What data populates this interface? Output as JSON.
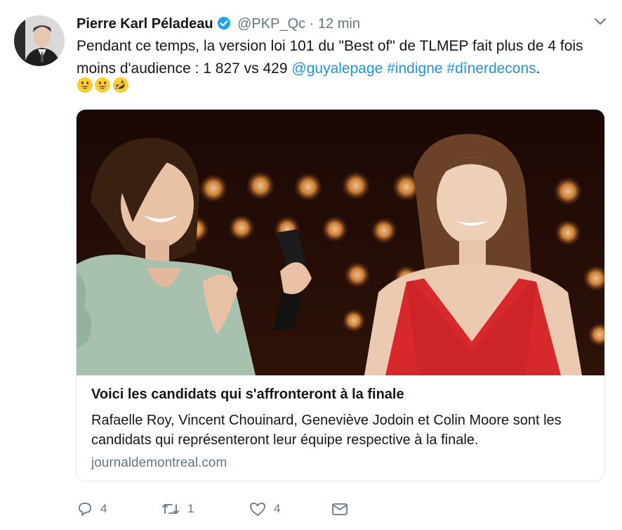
{
  "tweet": {
    "author_name": "Pierre Karl Péladeau",
    "handle": "@PKP_Qc",
    "separator": "·",
    "time": "12 min",
    "text_part1": "Pendant ce temps, la version loi 101 du \"Best of\" de TLMEP fait plus de 4 fois moins d'audience : 1 827 vs 429 ",
    "mention": "@guyalepage",
    "hashtag1": "#indigne",
    "hashtag2": "#dînerdecons",
    "text_end": ".",
    "emojis": [
      "grinning-face-emoji",
      "grinning-face-emoji",
      "rolling-on-floor-laughing-emoji"
    ]
  },
  "card": {
    "title": "Voici les candidats qui s'affronteront à la finale",
    "description": "Rafaelle Roy, Vincent Chouinard, Geneviève Jodoin et Colin Moore sont les candidats qui représenteront leur équipe respective à la finale.",
    "domain": "journaldemontreal.com"
  },
  "actions": {
    "reply_count": "4",
    "retweet_count": "1",
    "like_count": "4"
  },
  "colors": {
    "link": "#1b95e0",
    "secondary_text": "#657786",
    "verified": "#1da1f2",
    "border": "#e1e8ed",
    "dress_red": "#d7292c"
  }
}
